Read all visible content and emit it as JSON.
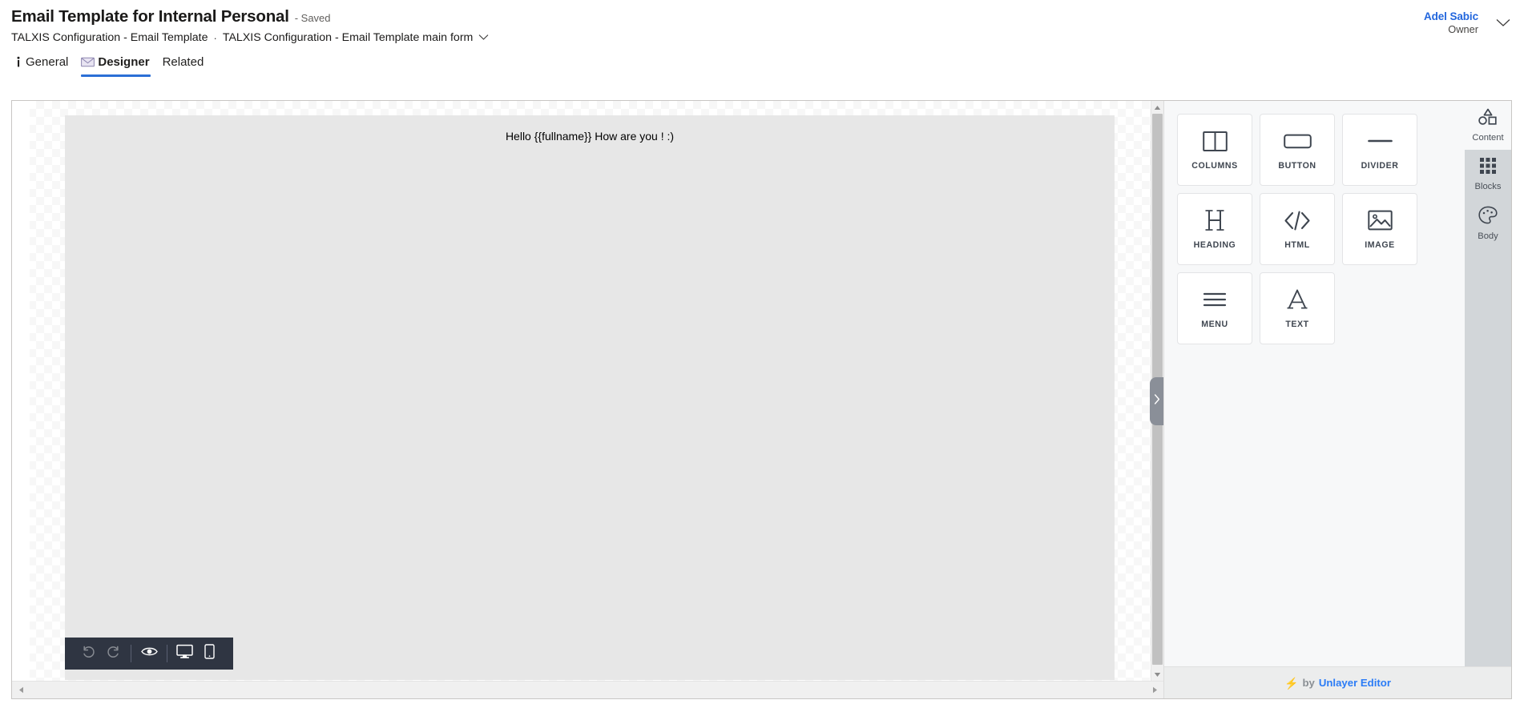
{
  "header": {
    "record_title": "Email Template for Internal Personal",
    "save_state": "- Saved",
    "breadcrumb": {
      "entity": "TALXIS Configuration - Email Template",
      "separator": "·",
      "form": "TALXIS Configuration - Email Template main form",
      "chevron_icon": "chevron-down-icon"
    },
    "user": {
      "name": "Adel Sabic",
      "role": "Owner",
      "chevron_icon": "chevron-down-icon"
    }
  },
  "tabs": [
    {
      "label": "General",
      "icon": "info-icon",
      "active": false
    },
    {
      "label": "Designer",
      "icon": "envelope-icon",
      "active": true
    },
    {
      "label": "Related",
      "icon": "",
      "active": false
    }
  ],
  "designer": {
    "email_body_text": "Hello {{fullname}} How are you ! :)",
    "toolbar": [
      {
        "name": "undo-button",
        "icon": "undo-icon",
        "label": "Undo",
        "disabled": true
      },
      {
        "name": "redo-button",
        "icon": "redo-icon",
        "label": "Redo",
        "disabled": true
      },
      {
        "name": "preview-button",
        "icon": "eye-icon",
        "label": "Preview",
        "disabled": false
      },
      {
        "name": "desktop-view-button",
        "icon": "desktop-icon",
        "label": "Desktop",
        "disabled": false
      },
      {
        "name": "mobile-view-button",
        "icon": "mobile-icon",
        "label": "Mobile",
        "disabled": false
      }
    ],
    "collapse_handle_icon": "chevron-right-icon",
    "scroll": {
      "up_arrow_icon": "caret-up-icon",
      "down_arrow_icon": "caret-down-icon",
      "left_arrow_icon": "caret-left-icon",
      "right_arrow_icon": "caret-right-icon"
    }
  },
  "palette": {
    "blocks": [
      {
        "label": "COLUMNS",
        "icon": "columns-icon"
      },
      {
        "label": "BUTTON",
        "icon": "button-icon"
      },
      {
        "label": "DIVIDER",
        "icon": "divider-icon"
      },
      {
        "label": "HEADING",
        "icon": "heading-icon"
      },
      {
        "label": "HTML",
        "icon": "code-icon"
      },
      {
        "label": "IMAGE",
        "icon": "image-icon"
      },
      {
        "label": "MENU",
        "icon": "menu-icon"
      },
      {
        "label": "TEXT",
        "icon": "text-icon"
      }
    ]
  },
  "rail": {
    "items": [
      {
        "label": "Content",
        "icon": "shapes-icon",
        "active": true
      },
      {
        "label": "Blocks",
        "icon": "grid-icon",
        "active": false
      },
      {
        "label": "Body",
        "icon": "palette-icon",
        "active": false
      }
    ]
  },
  "footer": {
    "bolt_icon": "lightning-bolt-icon",
    "by_text": "by",
    "link_text": "Unlayer Editor"
  },
  "colors": {
    "accent_blue": "#2b6fd6",
    "link_blue": "#2b7cf6",
    "toolbar_dark": "#2f3542",
    "rail_gray": "#d2d6d9",
    "email_body_gray": "#e7e7e7"
  }
}
